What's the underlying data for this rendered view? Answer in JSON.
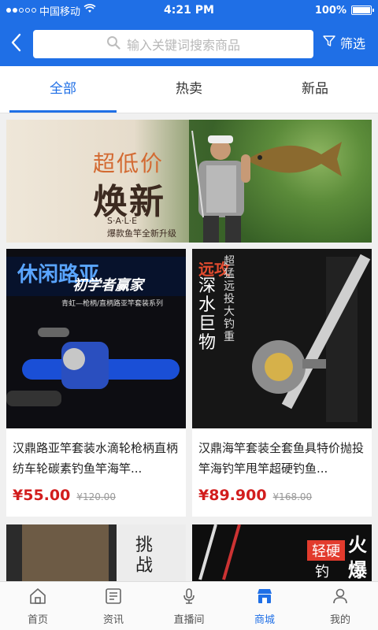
{
  "status": {
    "carrier": "中国移动",
    "time": "4:21 PM",
    "battery": "100%"
  },
  "search": {
    "placeholder": "输入关键词搜索商品",
    "filter_label": "筛选"
  },
  "tabs": [
    {
      "label": "全部",
      "active": true
    },
    {
      "label": "热卖",
      "active": false
    },
    {
      "label": "新品",
      "active": false
    }
  ],
  "banner": {
    "headline": "超低价",
    "subhead": "焕新",
    "sale": "S·A·L·E",
    "note": "爆款鱼竿全新升级"
  },
  "products": [
    {
      "title": "汉鼎路亚竿套装水滴轮枪柄直柄纺车轮碳素钓鱼竿海竿...",
      "price": "¥55.00",
      "old_price": "¥120.00",
      "image_text": [
        "休闲路亚",
        "初学者赢家",
        "青虹—枪柄/直柄路亚竿套装系列"
      ]
    },
    {
      "title": "汉鼎海竿套装全套鱼具特价抛投竿海钓竿甩竿超硬钓鱼...",
      "price": "¥89.900",
      "old_price": "¥168.00",
      "image_text": [
        "远攻",
        "深水巨物",
        "超猛远投大钓重"
      ]
    }
  ],
  "products_row2": [
    {
      "image_text": [
        "挑",
        "战"
      ]
    },
    {
      "image_text": [
        "轻硬",
        "钓",
        "火",
        "爆"
      ]
    }
  ],
  "bottom_nav": [
    {
      "label": "首页",
      "icon": "home-icon",
      "active": false
    },
    {
      "label": "资讯",
      "icon": "news-icon",
      "active": false
    },
    {
      "label": "直播间",
      "icon": "microphone-icon",
      "active": false
    },
    {
      "label": "商城",
      "icon": "shop-icon",
      "active": true
    },
    {
      "label": "我的",
      "icon": "user-icon",
      "active": false
    }
  ],
  "colors": {
    "accent": "#1f6fe6",
    "price": "#d21d1d"
  }
}
